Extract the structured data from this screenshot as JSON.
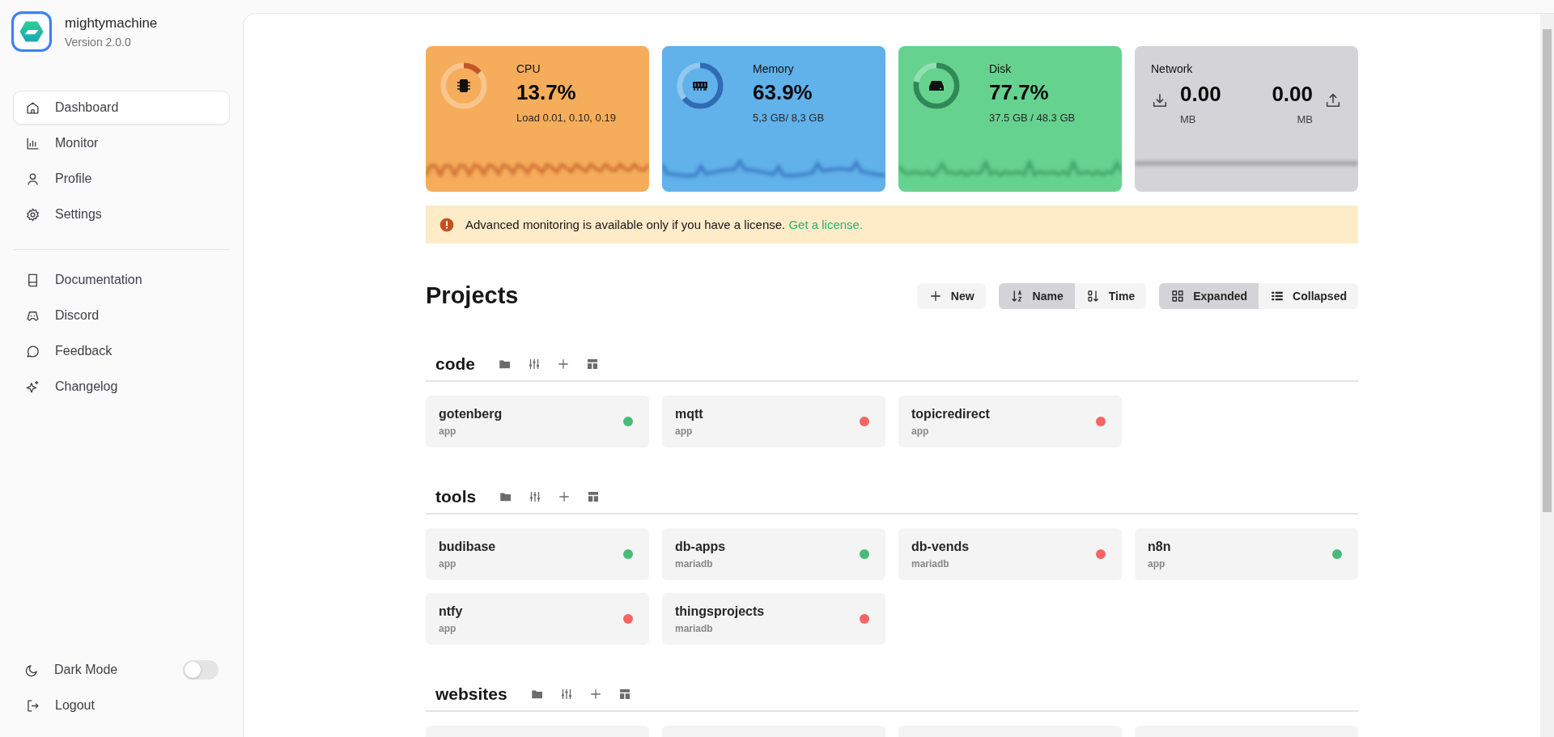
{
  "sidebar": {
    "app_name": "mightymachine",
    "version": "Version 2.0.0",
    "nav": [
      {
        "label": "Dashboard",
        "selected": true
      },
      {
        "label": "Monitor",
        "selected": false
      },
      {
        "label": "Profile",
        "selected": false
      },
      {
        "label": "Settings",
        "selected": false
      }
    ],
    "links": [
      {
        "label": "Documentation"
      },
      {
        "label": "Discord"
      },
      {
        "label": "Feedback"
      },
      {
        "label": "Changelog"
      }
    ],
    "dark_mode": {
      "label": "Dark Mode",
      "on": false
    },
    "logout": {
      "label": "Logout"
    }
  },
  "stats": [
    {
      "kind": "gauge",
      "label": "CPU",
      "value": "13.7%",
      "detail": "Load 0.01, 0.10, 0.19",
      "level": 0.137
    },
    {
      "kind": "gauge",
      "label": "Memory",
      "value": "63.9%",
      "detail": "5,3 GB/ 8,3 GB",
      "level": 0.639
    },
    {
      "kind": "gauge",
      "label": "Disk",
      "value": "77.7%",
      "detail": "37.5 GB / 48.3 GB",
      "level": 0.777
    },
    {
      "kind": "network",
      "label": "Network",
      "download": "0.00",
      "download_unit": "MB",
      "upload": "0.00",
      "upload_unit": "MB"
    }
  ],
  "alert": {
    "text": "Advanced monitoring is available only if you have a license.",
    "link": "Get a license."
  },
  "projects": {
    "title": "Projects",
    "new_button": "New",
    "sort": [
      {
        "label": "Name",
        "selected": true
      },
      {
        "label": "Time",
        "selected": false
      }
    ],
    "view": [
      {
        "label": "Expanded",
        "selected": true
      },
      {
        "label": "Collapsed",
        "selected": false
      }
    ],
    "groups": [
      {
        "name": "code",
        "projects": [
          {
            "name": "gotenberg",
            "type": "app",
            "color": "#48bb78"
          },
          {
            "name": "mqtt",
            "type": "app",
            "color": "#f56565"
          },
          {
            "name": "topicredirect",
            "type": "app",
            "color": "#f56565"
          }
        ]
      },
      {
        "name": "tools",
        "projects": [
          {
            "name": "budibase",
            "type": "app",
            "color": "#48bb78"
          },
          {
            "name": "db-apps",
            "type": "mariadb",
            "color": "#48bb78"
          },
          {
            "name": "db-vends",
            "type": "mariadb",
            "color": "#f56565"
          },
          {
            "name": "n8n",
            "type": "app",
            "color": "#48bb78"
          },
          {
            "name": "ntfy",
            "type": "app",
            "color": "#f56565"
          },
          {
            "name": "thingsprojects",
            "type": "mariadb",
            "color": "#f56565"
          }
        ]
      },
      {
        "name": "websites",
        "cut_off": true
      }
    ]
  }
}
